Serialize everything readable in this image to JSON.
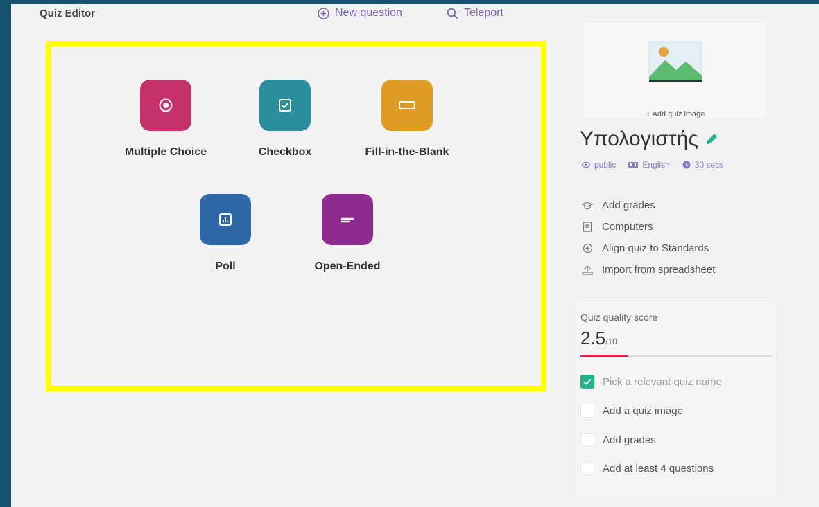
{
  "header": {
    "title": "Quiz Editor",
    "new_question": "New question",
    "teleport": "Teleport"
  },
  "question_types": [
    {
      "label": "Multiple Choice",
      "color": "#c7316a",
      "icon": "radio-icon"
    },
    {
      "label": "Checkbox",
      "color": "#2a8e9d",
      "icon": "checkbox-icon"
    },
    {
      "label": "Fill-in-the-Blank",
      "color": "#df9b22",
      "icon": "blank-icon"
    },
    {
      "label": "Poll",
      "color": "#2e67a8",
      "icon": "poll-icon"
    },
    {
      "label": "Open-Ended",
      "color": "#8e2b8f",
      "icon": "open-ended-icon"
    }
  ],
  "quiz": {
    "add_image": "+ Add quiz image",
    "title": "Υπολογιστής",
    "visibility": "public",
    "language": "English",
    "time": "30 secs"
  },
  "sidebar": {
    "items": [
      {
        "label": "Add grades",
        "icon": "grad-cap-icon"
      },
      {
        "label": "Computers",
        "icon": "book-icon"
      },
      {
        "label": "Align quiz to Standards",
        "icon": "target-icon"
      },
      {
        "label": "Import from spreadsheet",
        "icon": "import-icon"
      }
    ]
  },
  "quality": {
    "label": "Quiz quality score",
    "score": "2.5",
    "max": "/10",
    "progress": 0.25,
    "checklist": [
      {
        "label": "Pick a relevant quiz name",
        "done": true
      },
      {
        "label": "Add a quiz image",
        "done": false
      },
      {
        "label": "Add grades",
        "done": false
      },
      {
        "label": "Add at least 4 questions",
        "done": false
      }
    ]
  },
  "colors": {
    "accent": "#7a66b5",
    "highlight": "#ffff00",
    "success": "#1fb58c",
    "score_bar": "#e2254f"
  }
}
